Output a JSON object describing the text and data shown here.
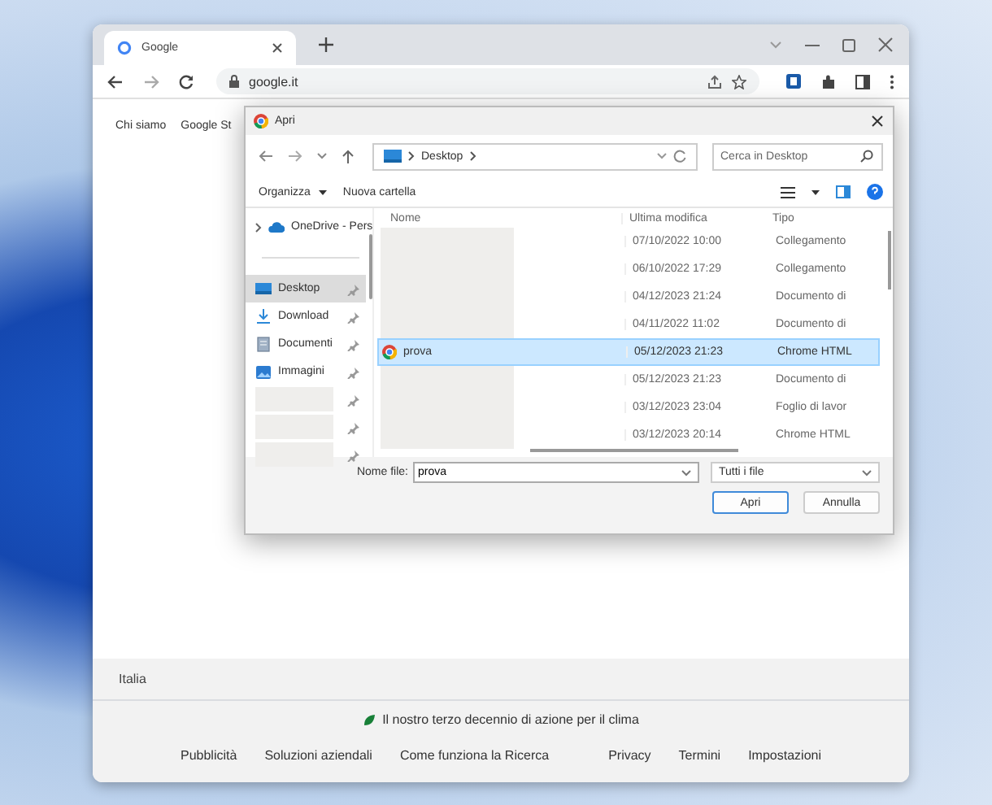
{
  "browser": {
    "tab": {
      "title": "Google"
    },
    "address": "google.it",
    "nav_links": [
      "Chi siamo",
      "Google St"
    ],
    "footer": {
      "country": "Italia",
      "climate": "Il nostro terzo decennio di azione per il clima",
      "left_links": [
        "Pubblicità",
        "Soluzioni aziendali",
        "Come funziona la Ricerca"
      ],
      "right_links": [
        "Privacy",
        "Termini",
        "Impostazioni"
      ]
    }
  },
  "dialog": {
    "title": "Apri",
    "path": "Desktop",
    "search": {
      "placeholder": "Cerca in Desktop"
    },
    "commands": [
      "Organizza",
      "Nuova cartella"
    ],
    "sidebar": [
      {
        "kind": "folder",
        "label": "OneDrive - Pers",
        "selected": false,
        "pinned": false
      },
      {
        "kind": "folder",
        "label": "Desktop",
        "selected": true,
        "pinned": true
      },
      {
        "kind": "folder",
        "label": "Download",
        "selected": false,
        "pinned": true
      },
      {
        "kind": "folder",
        "label": "Documenti",
        "selected": false,
        "pinned": true
      },
      {
        "kind": "folder",
        "label": "Immagini",
        "selected": false,
        "pinned": true
      },
      {
        "kind": "redacted",
        "pinned": true
      },
      {
        "kind": "redacted",
        "pinned": true
      },
      {
        "kind": "redacted",
        "pinned": true
      }
    ],
    "columns": [
      "Nome",
      "Ultima modifica",
      "Tipo"
    ],
    "rows": [
      {
        "kind": "redacted",
        "date": "07/10/2022 10:00",
        "type": "Collegamento",
        "selected": false
      },
      {
        "kind": "redacted",
        "date": "06/10/2022 17:29",
        "type": "Collegamento",
        "selected": false
      },
      {
        "kind": "redacted",
        "date": "04/12/2023 21:24",
        "type": "Documento di",
        "selected": false
      },
      {
        "kind": "redacted",
        "date": "04/11/2022 11:02",
        "type": "Documento di",
        "selected": false
      },
      {
        "kind": "file",
        "name": "prova",
        "date": "05/12/2023 21:23",
        "type": "Chrome HTML",
        "selected": true
      },
      {
        "kind": "redacted",
        "date": "05/12/2023 21:23",
        "type": "Documento di",
        "selected": false
      },
      {
        "kind": "redacted",
        "date": "03/12/2023 23:04",
        "type": "Foglio di lavor",
        "selected": false
      },
      {
        "kind": "redacted",
        "date": "03/12/2023 20:14",
        "type": "Chrome HTML",
        "selected": false
      }
    ],
    "filename_label": "Nome file:",
    "filename": "prova",
    "filter": "Tutti i file",
    "buttons": [
      "Apri",
      "Annulla"
    ]
  }
}
